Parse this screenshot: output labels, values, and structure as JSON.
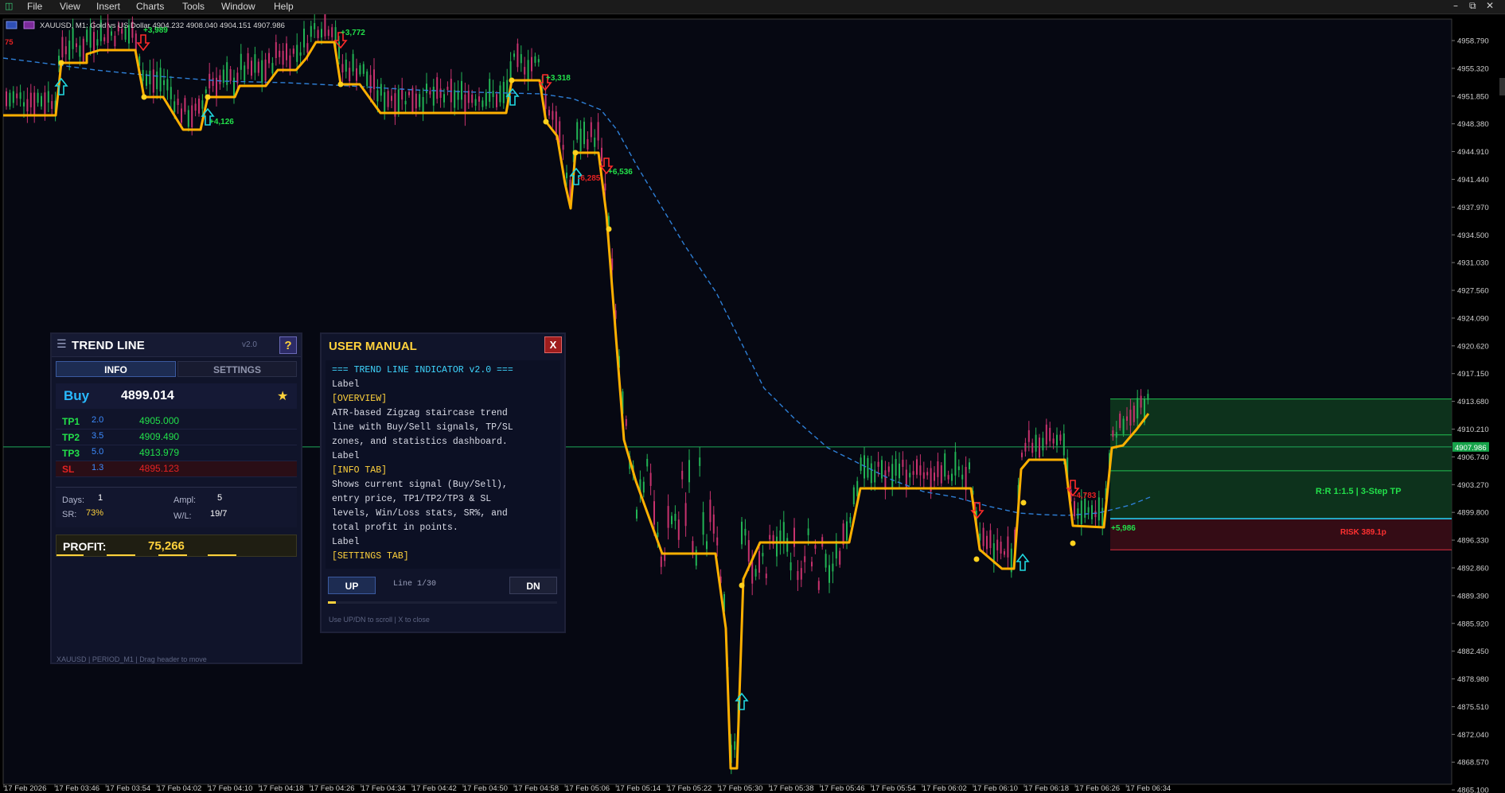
{
  "menubar": {
    "items": [
      "File",
      "View",
      "Insert",
      "Charts",
      "Tools",
      "Window",
      "Help"
    ],
    "window_controls": [
      "–",
      "⧉",
      "✕"
    ]
  },
  "chart": {
    "symbol_line": "XAUUSD, M1:  Gold vs US Dollar  4904.232 4908.040 4904.151 4907.986",
    "left_edge_label": "75",
    "price_ticks": [
      "4958.790",
      "4955.320",
      "4951.850",
      "4948.380",
      "4944.910",
      "4941.440",
      "4937.970",
      "4934.500",
      "4931.030",
      "4927.560",
      "4924.090",
      "4920.620",
      "4917.150",
      "4913.680",
      "4910.210",
      "4906.740",
      "4903.270",
      "4899.800",
      "4896.330",
      "4892.860",
      "4889.390",
      "4885.920",
      "4882.450",
      "4878.980",
      "4875.510",
      "4872.040",
      "4868.570",
      "4865.100",
      "4861.630"
    ],
    "current_price_tag": "4907.986",
    "time_ticks": [
      "17 Feb 2026",
      "17 Feb 03:46",
      "17 Feb 03:54",
      "17 Feb 04:02",
      "17 Feb 04:10",
      "17 Feb 04:18",
      "17 Feb 04:26",
      "17 Feb 04:34",
      "17 Feb 04:42",
      "17 Feb 04:50",
      "17 Feb 04:58",
      "17 Feb 05:06",
      "17 Feb 05:14",
      "17 Feb 05:22",
      "17 Feb 05:30",
      "17 Feb 05:38",
      "17 Feb 05:46",
      "17 Feb 05:54",
      "17 Feb 06:02",
      "17 Feb 06:10",
      "17 Feb 06:18",
      "17 Feb 06:26",
      "17 Feb 06:34"
    ],
    "profit_labels": [
      {
        "text": "+3,989",
        "color": "#22e04a"
      },
      {
        "text": "+3,772",
        "color": "#22e04a"
      },
      {
        "text": "+4,126",
        "color": "#22e04a"
      },
      {
        "text": "+3,318",
        "color": "#22e04a"
      },
      {
        "text": "+6,536",
        "color": "#22e04a"
      },
      {
        "text": "-6,285",
        "color": "#e42222"
      },
      {
        "text": "-4,783",
        "color": "#e42222"
      },
      {
        "text": "+5,986",
        "color": "#22e04a"
      }
    ],
    "rr_label": "R:R  1:1.5  |  3-Step TP",
    "risk_label": "RISK  389.1p",
    "colors": {
      "bg": "#060812",
      "bull": "#22b455",
      "bear": "#c8326e",
      "staircase": "#ffb000",
      "ema": "#2e7fd6",
      "buy_arrow": "#20d8e0",
      "sell_arrow": "#ff2a2a"
    }
  },
  "trend_panel": {
    "title": "TREND LINE",
    "version": "v2.0",
    "help": "?",
    "tabs": {
      "info": "INFO",
      "settings": "SETTINGS"
    },
    "signal": "Buy",
    "entry": "4899.014",
    "star": "★",
    "levels": [
      {
        "label": "TP1",
        "ratio": "2.0",
        "value": "4905.000",
        "color": "#22e04a"
      },
      {
        "label": "TP2",
        "ratio": "3.5",
        "value": "4909.490",
        "color": "#22e04a"
      },
      {
        "label": "TP3",
        "ratio": "5.0",
        "value": "4913.979",
        "color": "#22e04a"
      },
      {
        "label": "SL",
        "ratio": "1.3",
        "value": "4895.123",
        "color": "#e42222"
      }
    ],
    "stats": {
      "days_label": "Days:",
      "days": "1",
      "ampl_label": "Ampl:",
      "ampl": "5",
      "sr_label": "SR:",
      "sr": "73%",
      "wl_label": "W/L:",
      "wl": "19/7"
    },
    "profit_label": "PROFIT:",
    "profit": "75,266",
    "footer": "XAUUSD | PERIOD_M1 | Drag header to move"
  },
  "manual_panel": {
    "title": "USER MANUAL",
    "close": "X",
    "lines": [
      {
        "text": "=== TREND LINE INDICATOR v2.0 ===",
        "color": "#3fd6ff"
      },
      {
        "text": "Label",
        "color": "#d9dbe6"
      },
      {
        "text": "[OVERVIEW]",
        "color": "#ffd23c"
      },
      {
        "text": "ATR-based Zigzag staircase trend",
        "color": "#d9dbe6"
      },
      {
        "text": "line with Buy/Sell signals, TP/SL",
        "color": "#d9dbe6"
      },
      {
        "text": "zones, and statistics dashboard.",
        "color": "#d9dbe6"
      },
      {
        "text": "Label",
        "color": "#d9dbe6"
      },
      {
        "text": "[INFO TAB]",
        "color": "#ffd23c"
      },
      {
        "text": "Shows current signal (Buy/Sell),",
        "color": "#d9dbe6"
      },
      {
        "text": "entry price, TP1/TP2/TP3 & SL",
        "color": "#d9dbe6"
      },
      {
        "text": "levels, Win/Loss stats, SR%, and",
        "color": "#d9dbe6"
      },
      {
        "text": "total profit in points.",
        "color": "#d9dbe6"
      },
      {
        "text": "Label",
        "color": "#d9dbe6"
      },
      {
        "text": "[SETTINGS TAB]",
        "color": "#ffd23c"
      }
    ],
    "btn_up": "UP",
    "btn_dn": "DN",
    "line_info": "Line 1/30",
    "scroll_progress": 0.033,
    "hint": "Use UP/DN to scroll | X to close"
  }
}
